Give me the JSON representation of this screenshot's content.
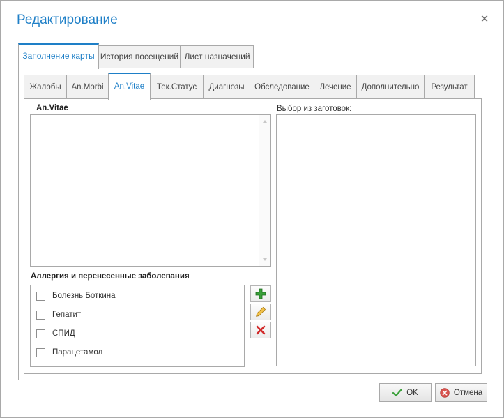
{
  "dialog": {
    "title": "Редактирование",
    "close_icon": "close-icon"
  },
  "outer_tabs": [
    {
      "label": "Заполнение карты",
      "active": true
    },
    {
      "label": "История посещений",
      "active": false
    },
    {
      "label": "Лист назначений",
      "active": false
    }
  ],
  "inner_tabs": [
    {
      "label": "Жалобы",
      "active": false
    },
    {
      "label": "An.Morbi",
      "active": false
    },
    {
      "label": "An.Vitae",
      "active": true
    },
    {
      "label": "Тек.Статус",
      "active": false
    },
    {
      "label": "Диагнозы",
      "active": false
    },
    {
      "label": "Обследование",
      "active": false
    },
    {
      "label": "Лечение",
      "active": false
    },
    {
      "label": "Дополнительно",
      "active": false
    },
    {
      "label": "Результат",
      "active": false
    }
  ],
  "anvitae": {
    "label": "An.Vitae",
    "value": ""
  },
  "templates": {
    "label": "Выбор из заготовок:"
  },
  "allergies": {
    "label": "Аллергия и перенесенные заболевания",
    "items": [
      {
        "label": "Болезнь Боткина",
        "checked": false
      },
      {
        "label": "Гепатит",
        "checked": false
      },
      {
        "label": "СПИД",
        "checked": false
      },
      {
        "label": "Парацетамол",
        "checked": false
      }
    ],
    "actions": [
      "add-icon",
      "edit-icon",
      "delete-icon"
    ]
  },
  "footer": {
    "ok_label": "OK",
    "cancel_label": "Отмена"
  },
  "colors": {
    "accent": "#1e7fc7",
    "border": "#a9a9a9",
    "add_green": "#3aa03a",
    "delete_red": "#d22b2b"
  }
}
